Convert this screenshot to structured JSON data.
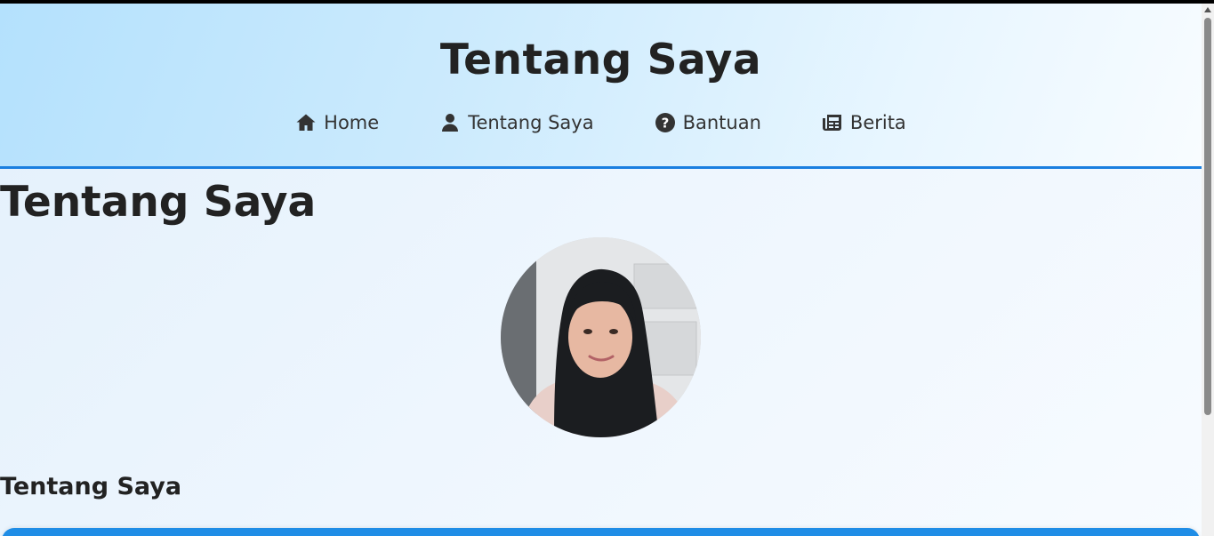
{
  "header": {
    "site_title": "Tentang Saya",
    "nav": [
      {
        "label": "Home",
        "icon": "home-icon"
      },
      {
        "label": "Tentang Saya",
        "icon": "user-icon"
      },
      {
        "label": "Bantuan",
        "icon": "question-circle-icon"
      },
      {
        "label": "Berita",
        "icon": "newspaper-icon"
      }
    ]
  },
  "main": {
    "page_title": "Tentang Saya",
    "profile_photo": "profile-photo",
    "section_title": "Tentang Saya"
  },
  "colors": {
    "accent": "#1a7fe0",
    "card": "#1f8de6",
    "header_gradient_start": "#b4e1fd",
    "header_gradient_end": "#f8fcff"
  }
}
